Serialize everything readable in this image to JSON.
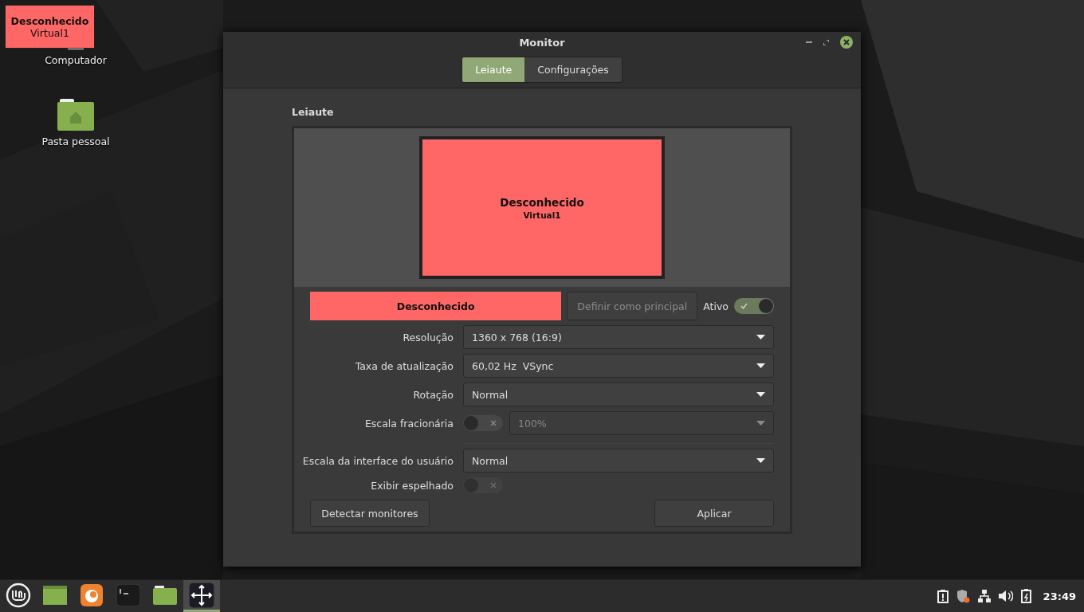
{
  "desktop": {
    "icons": [
      {
        "kind": "computer",
        "label": "Computador"
      },
      {
        "kind": "home",
        "label": "Pasta pessoal"
      }
    ],
    "overlay": {
      "title": "Desconhecido",
      "subtitle": "Virtual1"
    }
  },
  "window": {
    "title": "Monitor",
    "tabs": [
      {
        "label": "Leiaute",
        "selected": true
      },
      {
        "label": "Configurações",
        "selected": false
      }
    ],
    "section": "Leiaute",
    "monitor": {
      "name": "Desconhecido",
      "connector": "Virtual1",
      "color": "#ff6666"
    },
    "monitor_bar": {
      "name": "Desconhecido"
    },
    "set_primary": {
      "label": "Definir como principal",
      "disabled": true
    },
    "active": {
      "label": "Ativo",
      "on": true
    },
    "rows": [
      {
        "kind": "dropdown",
        "label": "Resolução",
        "value": "1360 x 768 (16:9)"
      },
      {
        "kind": "dropdown",
        "label": "Taxa de atualização",
        "value": "60,02 Hz  VSync"
      },
      {
        "kind": "dropdown",
        "label": "Rotação",
        "value": "Normal"
      },
      {
        "kind": "toggle_dropdown",
        "label": "Escala fracionária",
        "on": false,
        "value": "100%",
        "disabled": true
      },
      {
        "kind": "separator"
      },
      {
        "kind": "dropdown",
        "label": "Escala da interface do usuário",
        "value": "Normal"
      },
      {
        "kind": "toggle",
        "label": "Exibir espelhado",
        "on": false,
        "disabled": true
      }
    ],
    "buttons": [
      {
        "label": "Detectar monitores"
      },
      {
        "label": "Aplicar"
      }
    ]
  },
  "taskbar": {
    "apps": [
      {
        "kind": "files",
        "selected": false
      },
      {
        "kind": "browser",
        "selected": false
      },
      {
        "kind": "terminal",
        "selected": false
      },
      {
        "kind": "folder",
        "selected": false
      },
      {
        "kind": "move",
        "selected": true
      }
    ],
    "clock": "23:49"
  }
}
